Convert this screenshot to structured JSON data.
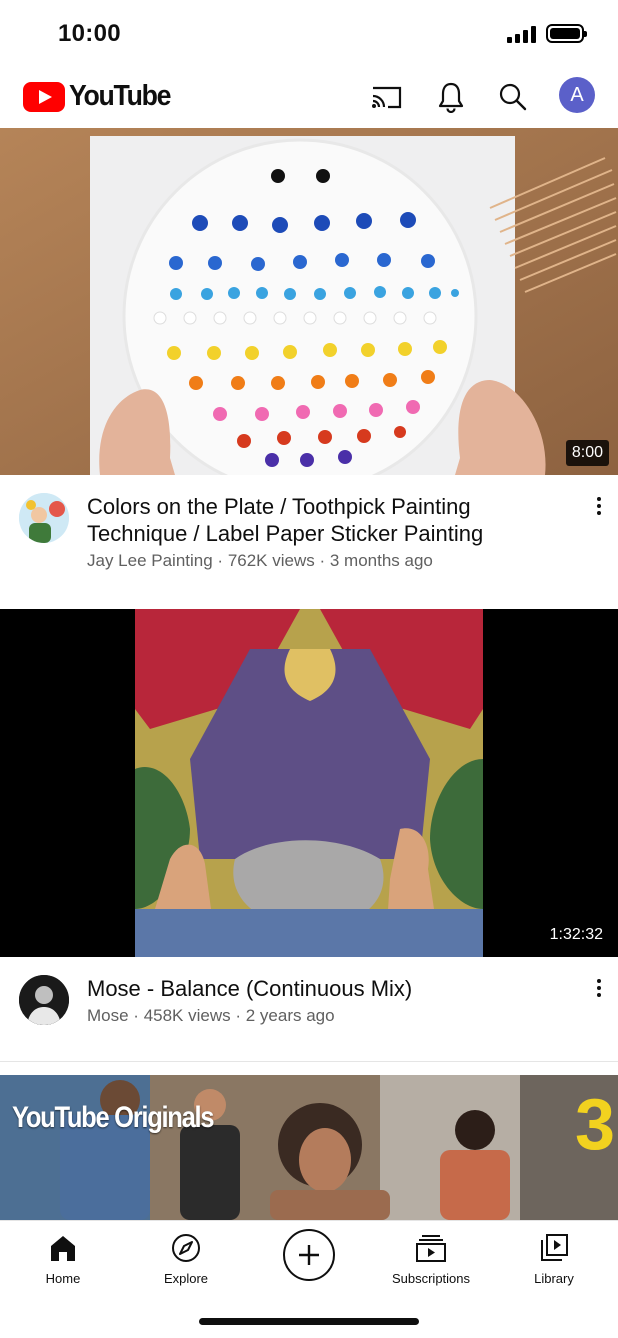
{
  "status_bar": {
    "time": "10:00"
  },
  "header": {
    "logo_text": "YouTube",
    "icons": [
      "cast-icon",
      "notifications-icon",
      "search-icon"
    ],
    "avatar_letter": "A",
    "avatar_color": "#5b60c9",
    "brand_color": "#ff0000"
  },
  "videos": [
    {
      "title_line1": "Colors on the Plate / Toothpick Painting",
      "title_line2": "Technique  / Label Paper Sticker Painting",
      "channel": "Jay Lee Painting",
      "views": "762K views",
      "age": "3 months ago",
      "duration": "8:00"
    },
    {
      "title_line1": "Mose - Balance (Continuous Mix)",
      "channel": "Mose",
      "views": "458K views",
      "age": "2 years ago",
      "duration": "1:32:32"
    },
    {
      "banner_text": "YouTube Originals",
      "banner_number": "3"
    }
  ],
  "bottom_nav": {
    "items": [
      {
        "label": "Home",
        "icon": "home-icon",
        "active": true
      },
      {
        "label": "Explore",
        "icon": "compass-icon"
      },
      {
        "label": "",
        "icon": "create-plus-icon"
      },
      {
        "label": "Subscriptions",
        "icon": "subscriptions-icon"
      },
      {
        "label": "Library",
        "icon": "library-icon"
      }
    ]
  }
}
